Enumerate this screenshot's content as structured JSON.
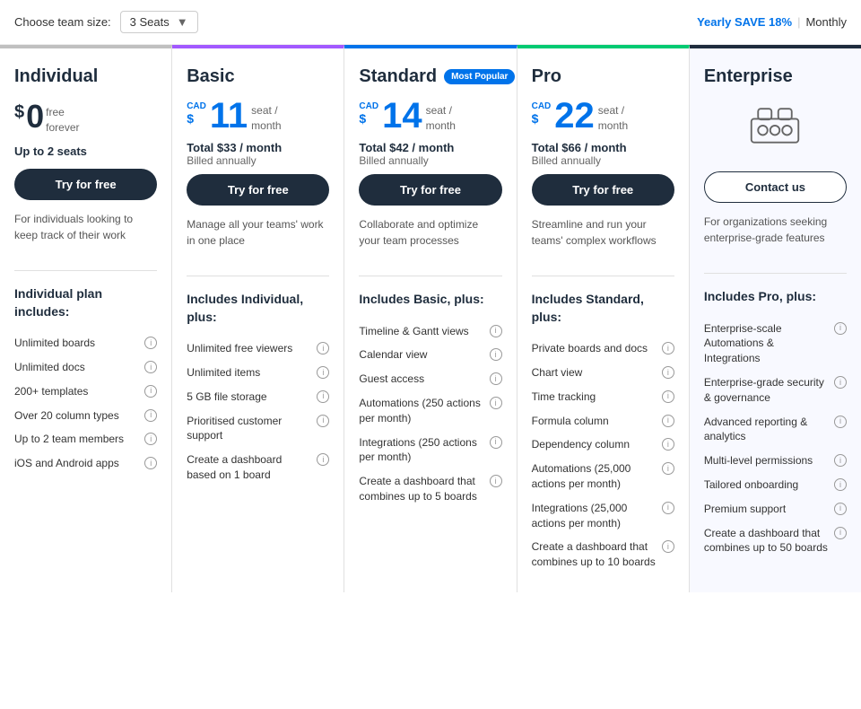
{
  "topBar": {
    "teamSizeLabel": "Choose team size:",
    "seatOption": "3 Seats",
    "billingYearly": "Yearly SAVE 18%",
    "billingSep": "|",
    "billingMonthly": "Monthly"
  },
  "plans": [
    {
      "id": "individual",
      "name": "Individual",
      "colorClass": "plan-individual",
      "priceCurrencyLabel": "",
      "dollarSign": "$",
      "priceAmount": "0",
      "priceFree": "free\nforever",
      "priceUnit": "",
      "totalPrice": "",
      "billedNote": "",
      "seatsNote": "Up to 2 seats",
      "btnLabel": "Try for free",
      "btnType": "try",
      "description": "For individuals looking to keep track of their work",
      "mostPopular": false,
      "includesHeader": "Individual plan includes:",
      "features": [
        "Unlimited boards",
        "Unlimited docs",
        "200+ templates",
        "Over 20 column types",
        "Up to 2 team members",
        "iOS and Android apps"
      ]
    },
    {
      "id": "basic",
      "name": "Basic",
      "colorClass": "plan-basic",
      "priceCurrencyLabel": "CAD",
      "dollarSign": "$",
      "priceAmount": "11",
      "priceUnit": "seat /\nmonth",
      "totalPrice": "Total $33 / month",
      "billedNote": "Billed annually",
      "seatsNote": "",
      "btnLabel": "Try for free",
      "btnType": "try",
      "description": "Manage all your teams' work in one place",
      "mostPopular": false,
      "includesHeader": "Includes Individual, plus:",
      "features": [
        "Unlimited free viewers",
        "Unlimited items",
        "5 GB file storage",
        "Prioritised customer support",
        "Create a dashboard based on 1 board"
      ]
    },
    {
      "id": "standard",
      "name": "Standard",
      "colorClass": "plan-standard",
      "priceCurrencyLabel": "CAD",
      "dollarSign": "$",
      "priceAmount": "14",
      "priceUnit": "seat /\nmonth",
      "totalPrice": "Total $42 / month",
      "billedNote": "Billed annually",
      "seatsNote": "",
      "btnLabel": "Try for free",
      "btnType": "try",
      "description": "Collaborate and optimize your team processes",
      "mostPopular": true,
      "mostPopularLabel": "Most Popular",
      "includesHeader": "Includes Basic, plus:",
      "features": [
        "Timeline & Gantt views",
        "Calendar view",
        "Guest access",
        "Automations (250 actions per month)",
        "Integrations (250 actions per month)",
        "Create a dashboard that combines up to 5 boards"
      ]
    },
    {
      "id": "pro",
      "name": "Pro",
      "colorClass": "plan-pro",
      "priceCurrencyLabel": "CAD",
      "dollarSign": "$",
      "priceAmount": "22",
      "priceUnit": "seat /\nmonth",
      "totalPrice": "Total $66 / month",
      "billedNote": "Billed annually",
      "seatsNote": "",
      "btnLabel": "Try for free",
      "btnType": "try",
      "description": "Streamline and run your teams' complex workflows",
      "mostPopular": false,
      "includesHeader": "Includes Standard, plus:",
      "features": [
        "Private boards and docs",
        "Chart view",
        "Time tracking",
        "Formula column",
        "Dependency column",
        "Automations (25,000 actions per month)",
        "Integrations (25,000 actions per month)",
        "Create a dashboard that combines up to 10 boards"
      ]
    },
    {
      "id": "enterprise",
      "name": "Enterprise",
      "colorClass": "plan-enterprise",
      "priceCurrencyLabel": "",
      "dollarSign": "",
      "priceAmount": "",
      "priceUnit": "",
      "totalPrice": "",
      "billedNote": "",
      "seatsNote": "",
      "btnLabel": "Contact us",
      "btnType": "contact",
      "description": "For organizations seeking enterprise-grade features",
      "mostPopular": false,
      "includesHeader": "Includes Pro, plus:",
      "features": [
        "Enterprise-scale Automations & Integrations",
        "Enterprise-grade security & governance",
        "Advanced reporting & analytics",
        "Multi-level permissions",
        "Tailored onboarding",
        "Premium support",
        "Create a dashboard that combines up to 50 boards"
      ]
    }
  ]
}
